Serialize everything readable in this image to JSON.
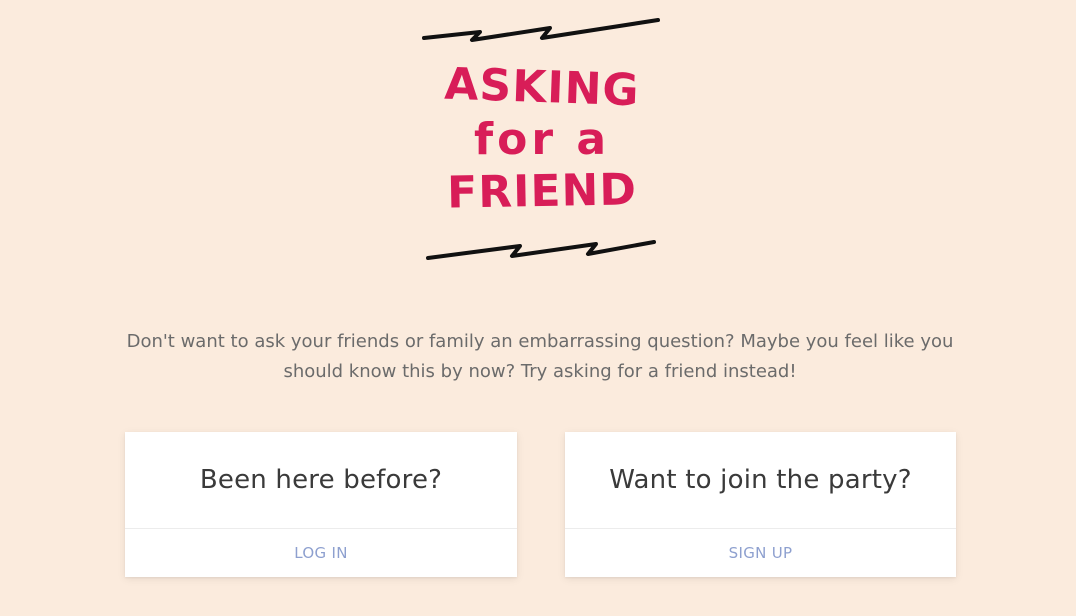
{
  "logo": {
    "line1": "ASKING",
    "line2": "for a",
    "line3": "FRIEND",
    "color": "#d81d58"
  },
  "tagline": "Don't want to ask your friends or family an embarrassing question? Maybe you feel like you should know this by now? Try asking for a friend instead!",
  "cards": {
    "login": {
      "title": "Been here before?",
      "action": "LOG IN"
    },
    "signup": {
      "title": "Want to join the party?",
      "action": "SIGN UP"
    }
  },
  "colors": {
    "background": "#fbebdd",
    "accent": "#d81d58",
    "link": "#8ea0cf"
  }
}
